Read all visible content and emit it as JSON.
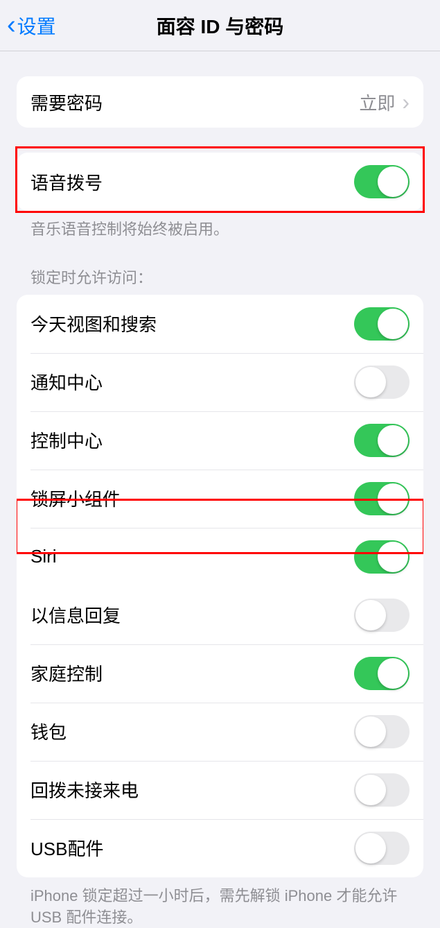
{
  "header": {
    "back_label": "设置",
    "title": "面容 ID 与密码"
  },
  "require_passcode": {
    "label": "需要密码",
    "value": "立即"
  },
  "voice_dial": {
    "label": "语音拨号",
    "enabled": true,
    "footer": "音乐语音控制将始终被启用。"
  },
  "lock_section": {
    "header": "锁定时允许访问：",
    "items": [
      {
        "label": "今天视图和搜索",
        "enabled": true
      },
      {
        "label": "通知中心",
        "enabled": false
      },
      {
        "label": "控制中心",
        "enabled": true
      },
      {
        "label": "锁屏小组件",
        "enabled": true
      },
      {
        "label": "Siri",
        "enabled": true
      },
      {
        "label": "以信息回复",
        "enabled": false
      },
      {
        "label": "家庭控制",
        "enabled": true
      },
      {
        "label": "钱包",
        "enabled": false
      },
      {
        "label": "回拨未接来电",
        "enabled": false
      },
      {
        "label": "USB配件",
        "enabled": false
      }
    ],
    "footer": "iPhone 锁定超过一小时后，需先解锁 iPhone 才能允许 USB 配件连接。"
  }
}
